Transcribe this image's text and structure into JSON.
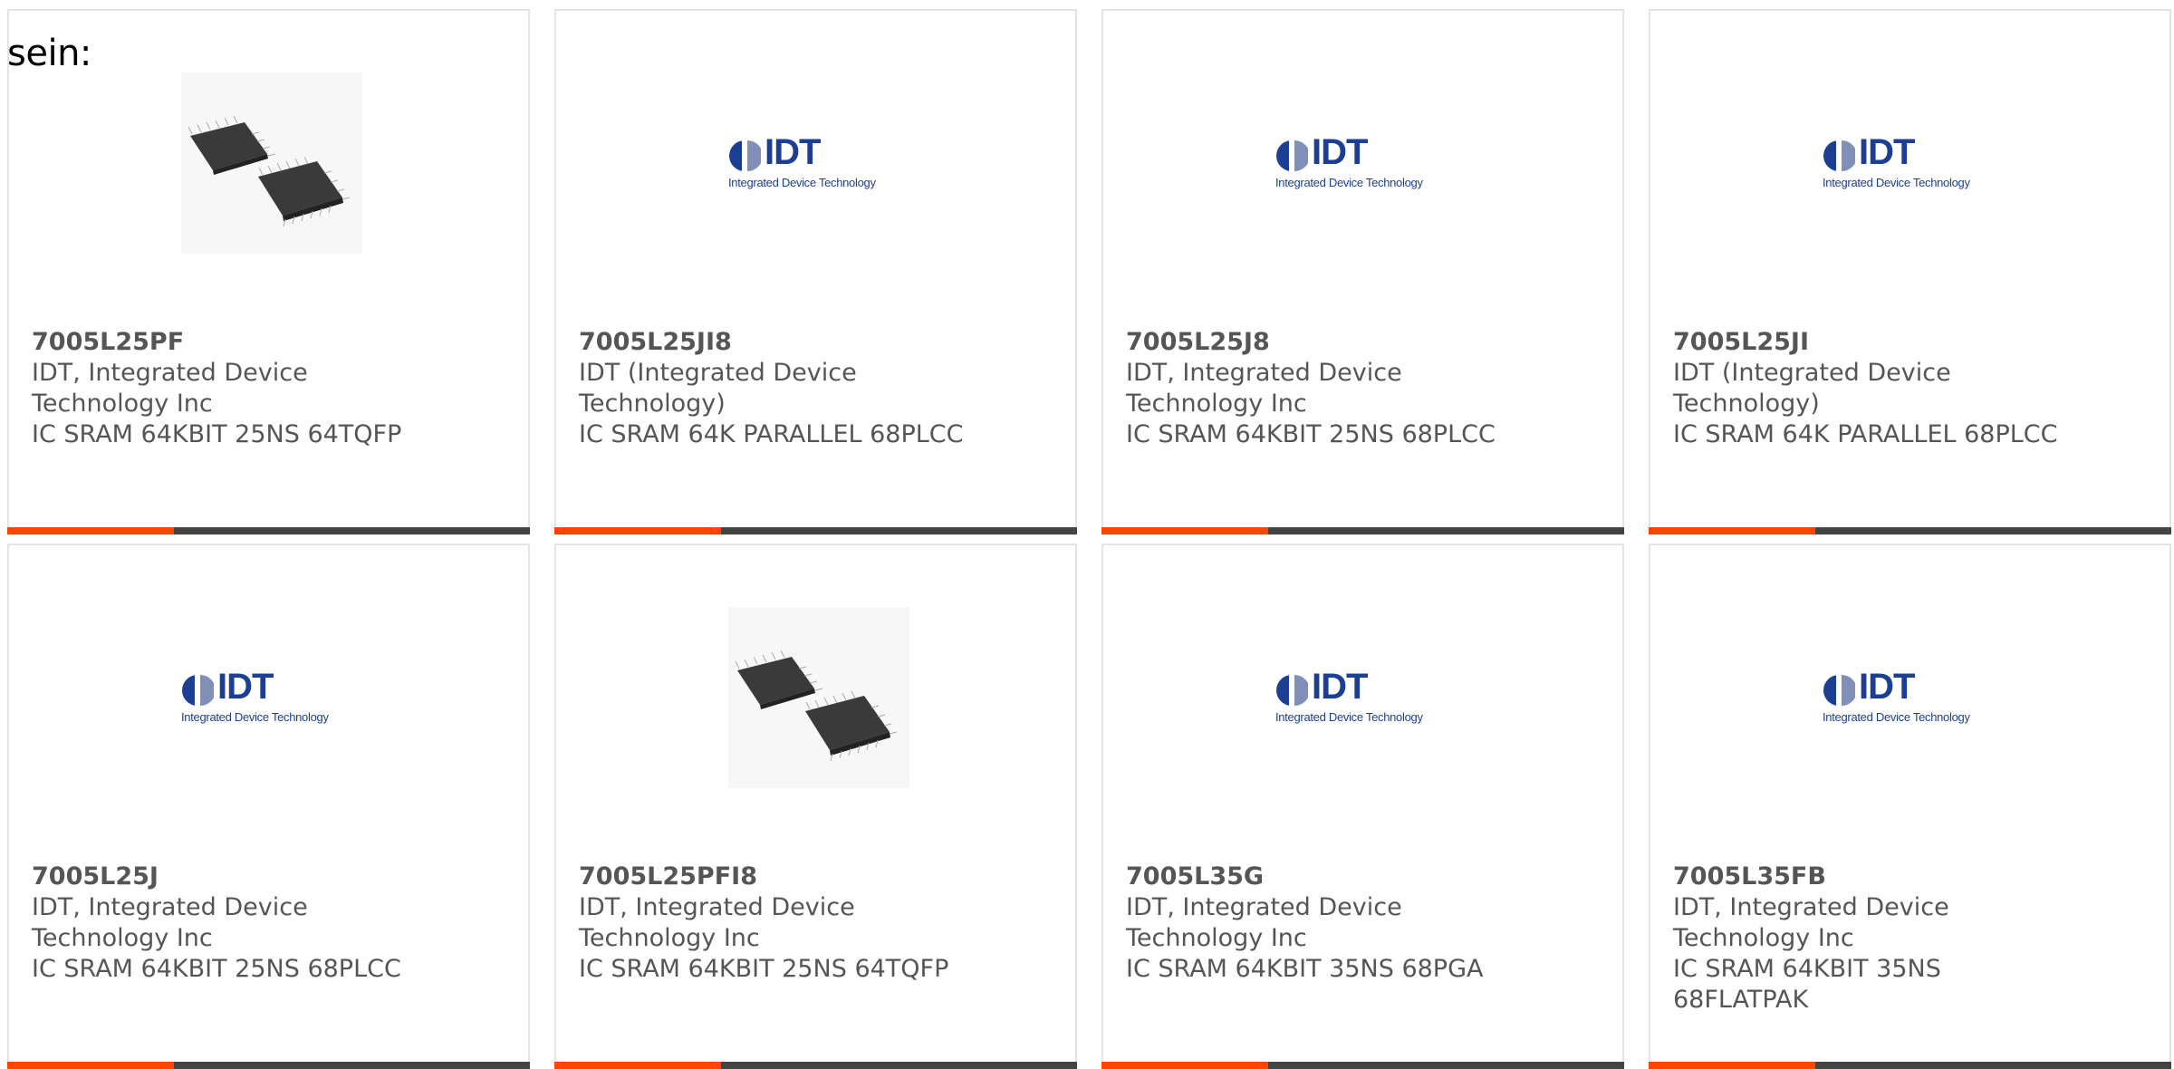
{
  "intro_text": "sein:",
  "colors": {
    "accent": "#ff4500",
    "bar": "#444444",
    "logo_blue": "#1c3f94"
  },
  "logo": {
    "name": "IDT",
    "tagline": "Integrated Device Technology"
  },
  "cards": [
    {
      "part": "7005L25PF",
      "mfr1": "IDT, Integrated Device",
      "mfr2": "Technology Inc",
      "desc1": "IC SRAM 64KBIT 25NS 64TQFP",
      "desc2": "",
      "image": "chip-photo"
    },
    {
      "part": "7005L25JI8",
      "mfr1": "IDT (Integrated Device",
      "mfr2": "Technology)",
      "desc1": "IC SRAM 64K PARALLEL 68PLCC",
      "desc2": "",
      "image": "idt-logo"
    },
    {
      "part": "7005L25J8",
      "mfr1": "IDT, Integrated Device",
      "mfr2": "Technology Inc",
      "desc1": "IC SRAM 64KBIT 25NS 68PLCC",
      "desc2": "",
      "image": "idt-logo"
    },
    {
      "part": "7005L25JI",
      "mfr1": "IDT (Integrated Device",
      "mfr2": "Technology)",
      "desc1": "IC SRAM 64K PARALLEL 68PLCC",
      "desc2": "",
      "image": "idt-logo"
    },
    {
      "part": "7005L25J",
      "mfr1": "IDT, Integrated Device",
      "mfr2": "Technology Inc",
      "desc1": "IC SRAM 64KBIT 25NS 68PLCC",
      "desc2": "",
      "image": "idt-logo"
    },
    {
      "part": "7005L25PFI8",
      "mfr1": "IDT, Integrated Device",
      "mfr2": "Technology Inc",
      "desc1": "IC SRAM 64KBIT 25NS 64TQFP",
      "desc2": "",
      "image": "chip-photo"
    },
    {
      "part": "7005L35G",
      "mfr1": "IDT, Integrated Device",
      "mfr2": "Technology Inc",
      "desc1": "IC SRAM 64KBIT 35NS 68PGA",
      "desc2": "",
      "image": "idt-logo"
    },
    {
      "part": "7005L35FB",
      "mfr1": "IDT, Integrated Device",
      "mfr2": "Technology Inc",
      "desc1": "IC SRAM 64KBIT 35NS",
      "desc2": "68FLATPAK",
      "image": "idt-logo"
    }
  ]
}
